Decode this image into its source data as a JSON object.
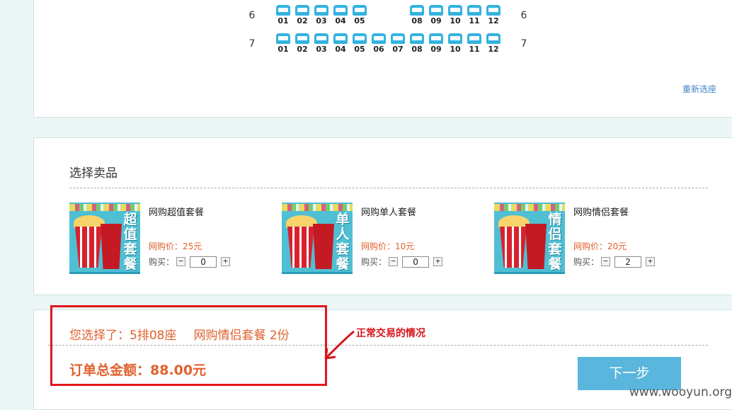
{
  "seat_map": {
    "rows": [
      {
        "label": "6",
        "seats": [
          "01",
          "02",
          "03",
          "04",
          "05",
          "08",
          "09",
          "10",
          "11",
          "12"
        ]
      },
      {
        "label": "7",
        "seats": [
          "01",
          "02",
          "03",
          "04",
          "05",
          "06",
          "07",
          "08",
          "09",
          "10",
          "11",
          "12"
        ]
      }
    ],
    "reselect_link": "重新选座"
  },
  "concessions": {
    "title": "选择卖品",
    "products": [
      {
        "name": "网购超值套餐",
        "price": "网购价：25元",
        "buy_label": "购买：",
        "quantity": "0",
        "image_text": "超值套餐"
      },
      {
        "name": "网购单人套餐",
        "price": "网购价：10元",
        "buy_label": "购买：",
        "quantity": "0",
        "image_text": "单人套餐"
      },
      {
        "name": "网购情侣套餐",
        "price": "网购价：20元",
        "buy_label": "购买：",
        "quantity": "2",
        "image_text": "情侣套餐"
      }
    ],
    "minus": "−",
    "plus": "+"
  },
  "summary": {
    "selected_seat": "您选择了：5排08座",
    "selected_meal": "网购情侣套餐 2份",
    "total": "订单总金额：88.00元",
    "next_button": "下一步"
  },
  "annotation": {
    "text": "正常交易的情况"
  },
  "watermark": "www.wooyun.org",
  "colors": {
    "accent_orange": "#e0612d",
    "seat_blue": "#33b3e0",
    "button_blue": "#5bb6dd",
    "annotation_red": "#e3161d",
    "link_blue": "#3f87c8"
  }
}
